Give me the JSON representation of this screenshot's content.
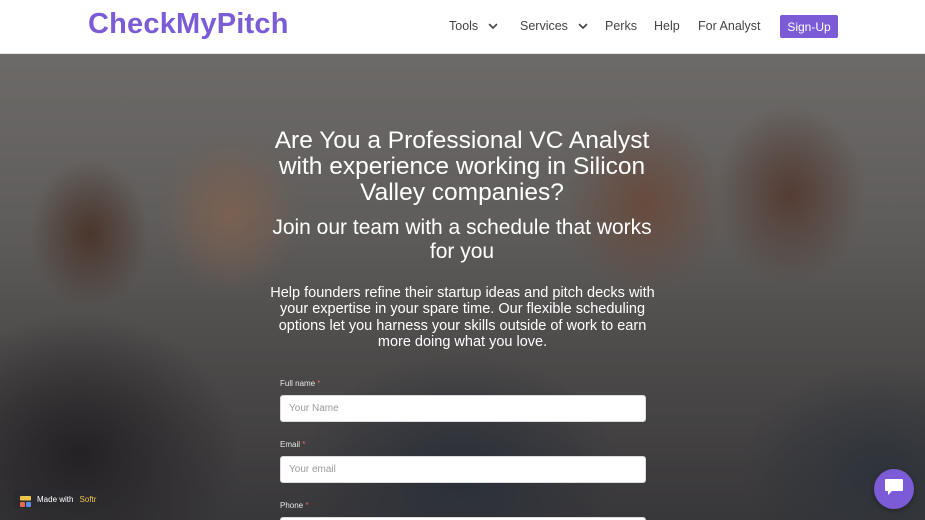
{
  "brand": {
    "logo": "CheckMyPitch",
    "accent_color": "#7b5cd6"
  },
  "nav": {
    "items": [
      {
        "label": "Tools",
        "has_dropdown": true
      },
      {
        "label": "Services",
        "has_dropdown": true
      },
      {
        "label": "Perks",
        "has_dropdown": false
      },
      {
        "label": "Help",
        "has_dropdown": false
      },
      {
        "label": "For Analyst",
        "has_dropdown": false
      }
    ],
    "signup_label": "Sign-Up"
  },
  "hero": {
    "headline": "Are You a Professional VC Analyst with experience working in Silicon Valley companies?",
    "subheadline": "Join our team with a schedule that works for you",
    "description": "Help founders refine their startup ideas and pitch decks with your expertise in your spare time. Our flexible scheduling options let you harness your skills outside of work to earn more doing what you love."
  },
  "form": {
    "full_name": {
      "label": "Full name",
      "required_mark": "*",
      "placeholder": "Your Name"
    },
    "email": {
      "label": "Email",
      "required_mark": "*",
      "placeholder": "Your email"
    },
    "phone": {
      "label": "Phone",
      "required_mark": "*"
    }
  },
  "badge": {
    "made_with": "Made with",
    "brand": "Softr"
  },
  "icons": {
    "chevron": "chevron-down-icon",
    "chat": "chat-icon",
    "softr": "softr-logo-icon"
  }
}
